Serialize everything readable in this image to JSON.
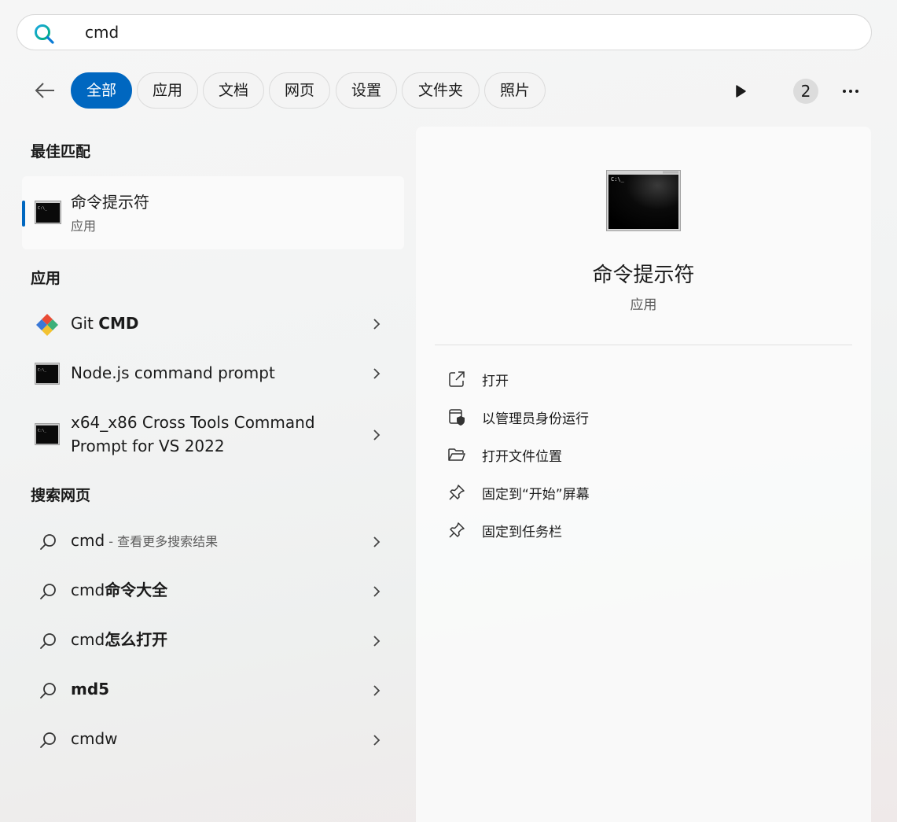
{
  "search": {
    "query": "cmd"
  },
  "filters": {
    "tabs": [
      {
        "label": "全部",
        "active": true
      },
      {
        "label": "应用"
      },
      {
        "label": "文档"
      },
      {
        "label": "网页"
      },
      {
        "label": "设置"
      },
      {
        "label": "文件夹"
      },
      {
        "label": "照片"
      }
    ],
    "badge_count": "2"
  },
  "best_match": {
    "section_title": "最佳匹配",
    "title": "命令提示符",
    "type": "应用",
    "icon": "cmd-icon"
  },
  "apps": {
    "section_title": "应用",
    "items": [
      {
        "label_plain": "Git ",
        "label_bold": "CMD",
        "icon": "git-icon"
      },
      {
        "label": "Node.js command prompt",
        "icon": "cmd-icon"
      },
      {
        "label_line1": "x64_x86 Cross Tools Command",
        "label_line2": "Prompt for VS 2022",
        "icon": "cmd-icon"
      }
    ]
  },
  "web": {
    "section_title": "搜索网页",
    "items": [
      {
        "plain": "cmd",
        "suffix": " - 查看更多搜索结果"
      },
      {
        "plain": "cmd",
        "bold": "命令大全"
      },
      {
        "plain": "cmd",
        "bold": "怎么打开"
      },
      {
        "bold": "md5"
      },
      {
        "plain": "cmdw"
      }
    ]
  },
  "detail": {
    "title": "命令提示符",
    "type": "应用",
    "actions": [
      {
        "label": "打开",
        "icon": "open-external-icon"
      },
      {
        "label": "以管理员身份运行",
        "icon": "shield-run-admin-icon"
      },
      {
        "label": "打开文件位置",
        "icon": "folder-open-icon"
      },
      {
        "label": "固定到“开始”屏幕",
        "icon": "pin-icon"
      },
      {
        "label": "固定到任务栏",
        "icon": "pin-icon"
      }
    ]
  },
  "colors": {
    "accent": "#0067c0"
  }
}
